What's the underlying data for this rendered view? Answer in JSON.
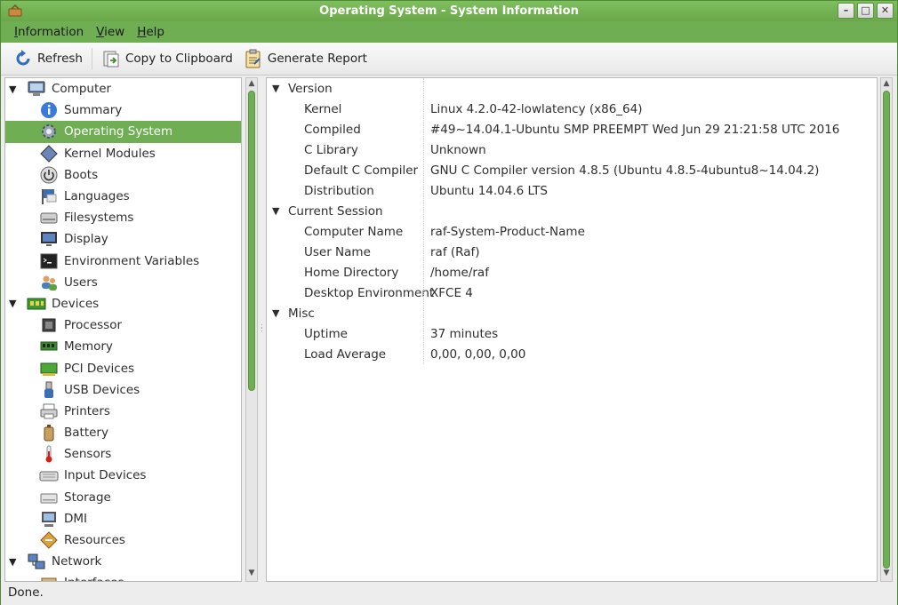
{
  "window": {
    "title": "Operating System - System Information"
  },
  "menubar": {
    "items": [
      {
        "label": "Information",
        "mnemonic": "I"
      },
      {
        "label": "View",
        "mnemonic": "V"
      },
      {
        "label": "Help",
        "mnemonic": "H"
      }
    ]
  },
  "toolbar": {
    "refresh": "Refresh",
    "copy": "Copy to Clipboard",
    "report": "Generate Report"
  },
  "tree": [
    {
      "label": "Computer",
      "type": "cat",
      "icon": "computer-icon"
    },
    {
      "label": "Summary",
      "type": "child",
      "icon": "info-icon"
    },
    {
      "label": "Operating System",
      "type": "child",
      "icon": "gear-icon",
      "selected": true
    },
    {
      "label": "Kernel Modules",
      "type": "child",
      "icon": "module-icon"
    },
    {
      "label": "Boots",
      "type": "child",
      "icon": "power-icon"
    },
    {
      "label": "Languages",
      "type": "child",
      "icon": "flag-icon"
    },
    {
      "label": "Filesystems",
      "type": "child",
      "icon": "drive-icon"
    },
    {
      "label": "Display",
      "type": "child",
      "icon": "monitor-icon"
    },
    {
      "label": "Environment Variables",
      "type": "child",
      "icon": "terminal-icon"
    },
    {
      "label": "Users",
      "type": "child",
      "icon": "users-icon"
    },
    {
      "label": "Devices",
      "type": "cat",
      "icon": "board-icon"
    },
    {
      "label": "Processor",
      "type": "child",
      "icon": "cpu-icon"
    },
    {
      "label": "Memory",
      "type": "child",
      "icon": "memory-icon"
    },
    {
      "label": "PCI Devices",
      "type": "child",
      "icon": "pci-icon"
    },
    {
      "label": "USB Devices",
      "type": "child",
      "icon": "usb-icon"
    },
    {
      "label": "Printers",
      "type": "child",
      "icon": "printer-icon"
    },
    {
      "label": "Battery",
      "type": "child",
      "icon": "battery-icon"
    },
    {
      "label": "Sensors",
      "type": "child",
      "icon": "thermometer-icon"
    },
    {
      "label": "Input Devices",
      "type": "child",
      "icon": "keyboard-icon"
    },
    {
      "label": "Storage",
      "type": "child",
      "icon": "storage-icon"
    },
    {
      "label": "DMI",
      "type": "child",
      "icon": "dmi-icon"
    },
    {
      "label": "Resources",
      "type": "child",
      "icon": "resources-icon"
    },
    {
      "label": "Network",
      "type": "cat",
      "icon": "network-icon"
    },
    {
      "label": "Interfaces",
      "type": "child",
      "icon": "interface-icon"
    }
  ],
  "details": [
    {
      "section": "Version",
      "rows": [
        {
          "key": "Kernel",
          "value": "Linux 4.2.0-42-lowlatency (x86_64)"
        },
        {
          "key": "Compiled",
          "value": "#49~14.04.1-Ubuntu SMP PREEMPT Wed Jun 29 21:21:58 UTC 2016"
        },
        {
          "key": "C Library",
          "value": "Unknown"
        },
        {
          "key": "Default C Compiler",
          "value": "GNU C Compiler version 4.8.5 (Ubuntu 4.8.5-4ubuntu8~14.04.2)"
        },
        {
          "key": "Distribution",
          "value": "Ubuntu 14.04.6 LTS"
        }
      ]
    },
    {
      "section": "Current Session",
      "rows": [
        {
          "key": "Computer Name",
          "value": "raf-System-Product-Name"
        },
        {
          "key": "User Name",
          "value": "raf (Raf)"
        },
        {
          "key": "Home Directory",
          "value": "/home/raf"
        },
        {
          "key": "Desktop Environment",
          "value": "XFCE 4"
        }
      ]
    },
    {
      "section": "Misc",
      "rows": [
        {
          "key": "Uptime",
          "value": "37 minutes"
        },
        {
          "key": "Load Average",
          "value": "0,00, 0,00, 0,00"
        }
      ]
    }
  ],
  "status": {
    "text": "Done."
  },
  "colors": {
    "accent": "#6fae52",
    "selection": "#6fae52"
  }
}
